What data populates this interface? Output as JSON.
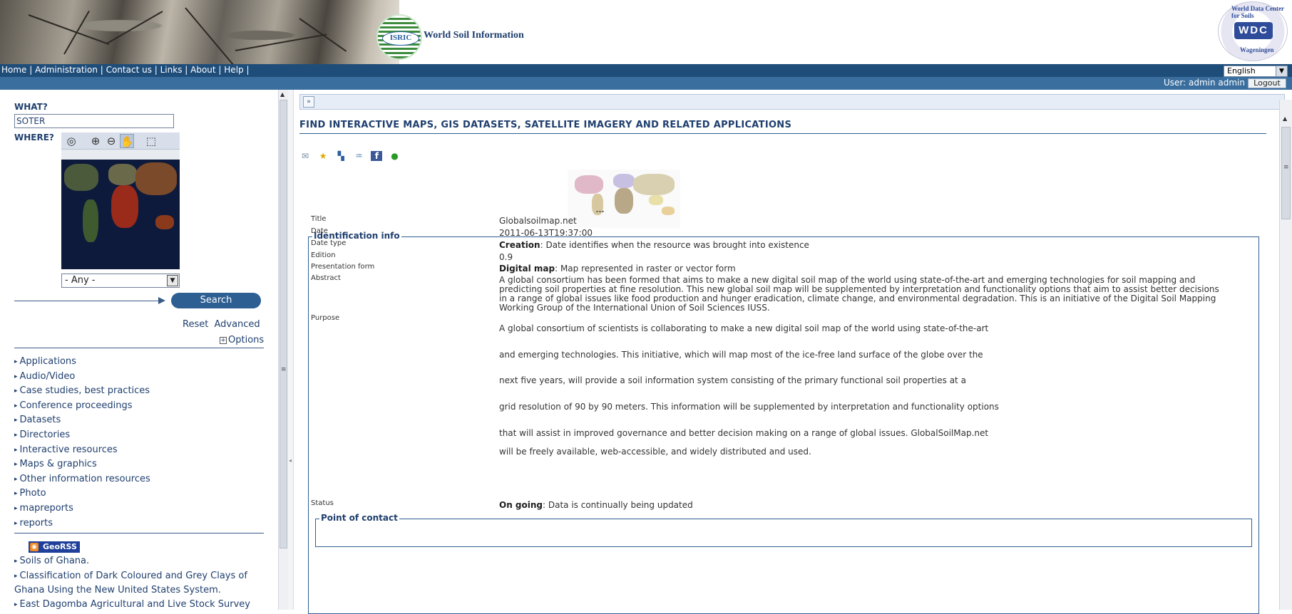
{
  "header": {
    "site_title": "World Soil Information",
    "isric_logo_text": "ISRIC",
    "wdc_logo_text": "WDC",
    "wdc_arc_top": "World Data Center for Soils",
    "wdc_arc_bottom": "Wageningen"
  },
  "nav": {
    "items": [
      "Home",
      "Administration",
      "Contact us",
      "Links",
      "About",
      "Help"
    ],
    "separator": " | ",
    "language": "English"
  },
  "userbar": {
    "user_text": "User: admin admin",
    "logout_label": "Logout"
  },
  "sidebar": {
    "what_label": "WHAT?",
    "what_value": "SOTER",
    "where_label": "WHERE?",
    "region_value": "- Any -",
    "search_label": "Search",
    "reset_label": "Reset",
    "advanced_label": "Advanced",
    "options_label": "Options",
    "categories": [
      "Applications",
      "Audio/Video",
      "Case studies, best practices",
      "Conference proceedings",
      "Datasets",
      "Directories",
      "Interactive resources",
      "Maps & graphics",
      "Other information resources",
      "Photo",
      "mapreports",
      "reports"
    ],
    "georss_label": "GeoRSS",
    "rss_items": [
      "Soils of Ghana.",
      "Classification of Dark Coloured and Grey Clays of Ghana Using the New United States System.",
      "East Dagomba Agricultural and Live Stock Survey"
    ]
  },
  "main": {
    "heading": "FIND INTERACTIVE MAPS, GIS DATASETS, SATELLITE IMAGERY AND RELATED APPLICATIONS",
    "identification_title": "Identification info",
    "fields": {
      "title_label": "Title",
      "title_value": "Globalsoilmap.net",
      "date_label": "Date",
      "date_value": "2011-06-13T19:37:00",
      "datetype_label": "Date type",
      "datetype_bold": "Creation",
      "datetype_rest": ": Date identifies when the resource was brought into existence",
      "edition_label": "Edition",
      "edition_value": "0.9",
      "presentation_label": "Presentation form",
      "presentation_bold": "Digital map",
      "presentation_rest": ": Map represented in raster or vector form",
      "abstract_label": "Abstract",
      "abstract_value": "A global consortium has been formed that aims to make a new digital soil map of the world using state-of-the-art and emerging technologies for soil mapping and predicting soil properties at fine resolution. This new global soil map will be supplemented by interpretation and functionality options that aim to assist better decisions in a range of global issues like food production and hunger eradication, climate change, and environmental degradation. This is an initiative of the Digital Soil Mapping Working Group of the International Union of Soil Sciences IUSS.",
      "purpose_label": "Purpose",
      "purpose_lines": [
        "A global consortium of scientists is collaborating to make a new digital soil map of the world using state-of-the-art",
        "and emerging technologies. This initiative, which will map most of the ice-free land surface of the globe over the",
        "next five years, will provide a soil information system consisting of the primary functional soil properties at a",
        "grid resolution of 90 by 90 meters. This information will be supplemented by interpretation and functionality options",
        "that will assist in improved governance and better decision making on a range of global issues. GlobalSoilMap.net",
        "will be freely available, web-accessible, and widely distributed and used."
      ],
      "status_label": "Status",
      "status_bold": "On going",
      "status_rest": ": Data is continually being updated"
    },
    "contact_title": "Point of contact"
  }
}
